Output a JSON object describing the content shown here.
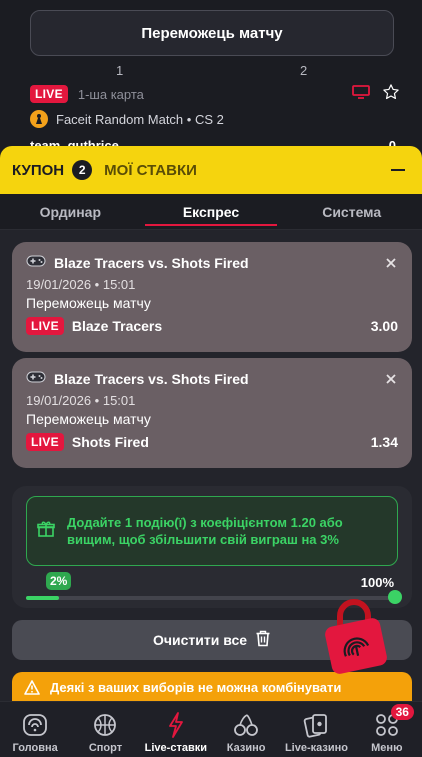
{
  "background": {
    "market_button": "Переможець матчу",
    "col1": "1",
    "col2": "2",
    "live": "LIVE",
    "map_label": "1-ша карта",
    "tournament": "Faceit Random Match • CS 2",
    "team": "team_guthrice",
    "team_score": "0"
  },
  "coupon": {
    "tab_coupon": "КУПОН",
    "count": "2",
    "tab_my_bets": "МОЇ СТАВКИ",
    "bet_types": [
      "Ординар",
      "Експрес",
      "Система"
    ],
    "active_bet_type": "Експрес",
    "bets": [
      {
        "title": "Blaze Tracers vs. Shots Fired",
        "date": "19/01/2026 • 15:01",
        "market": "Переможець матчу",
        "live": "LIVE",
        "selection": "Blaze Tracers",
        "odd": "3.00"
      },
      {
        "title": "Blaze Tracers vs. Shots Fired",
        "date": "19/01/2026 • 15:01",
        "market": "Переможець матчу",
        "live": "LIVE",
        "selection": "Shots Fired",
        "odd": "1.34"
      }
    ],
    "bonus": {
      "message": "Додайте 1 подію(ї) з коефіцієнтом 1.20 або вищим, щоб збільшити свій виграш на 3%",
      "progress_start": "2%",
      "progress_end": "100%",
      "progress_fraction": 0.09
    },
    "clear_button": "Очистити все",
    "warning": "Деякі з ваших виборів не можна комбінувати"
  },
  "nav": {
    "items": [
      {
        "label": "Головна",
        "icon": "home-icon"
      },
      {
        "label": "Спорт",
        "icon": "basketball-icon"
      },
      {
        "label": "Live-ставки",
        "icon": "lightning-icon"
      },
      {
        "label": "Казино",
        "icon": "cherries-icon"
      },
      {
        "label": "Live-казино",
        "icon": "cards-icon"
      },
      {
        "label": "Меню",
        "icon": "menu-grid-icon"
      }
    ],
    "active": "Live-ставки",
    "menu_badge": "36"
  },
  "colors": {
    "accent_yellow": "#f5d40e",
    "live_red": "#e3173e",
    "bonus_green": "#3bd365",
    "warning_orange": "#f4a10a"
  }
}
